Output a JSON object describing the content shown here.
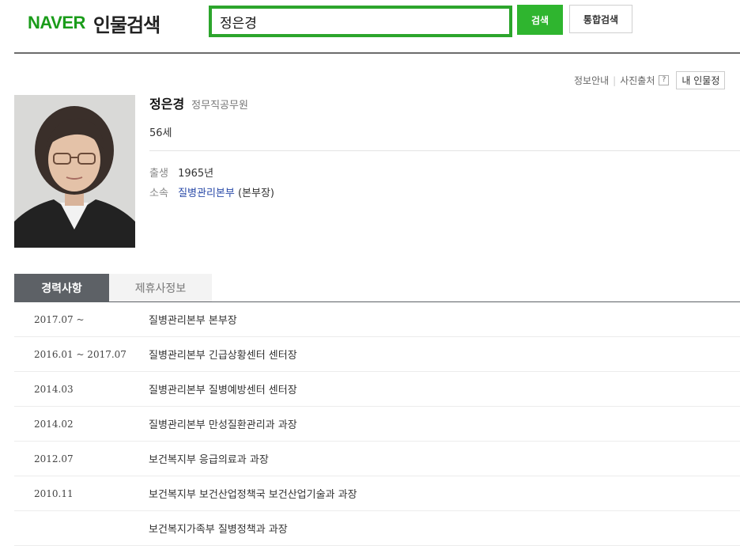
{
  "header": {
    "logo_brand": "NAVER",
    "logo_service": "인물검색",
    "search_value": "정은경",
    "search_button": "검색",
    "total_search_button": "통합검색"
  },
  "info_links": {
    "info": "정보안내",
    "photo_source": "사진출처",
    "help": "?",
    "my_person": "내 인물정"
  },
  "profile": {
    "name": "정은경",
    "job": "정무직공무원",
    "age": "56세",
    "birth_label": "출생",
    "birth_value": "1965년",
    "affiliation_label": "소속",
    "affiliation_link": "질병관리본부",
    "affiliation_role": " (본부장)"
  },
  "tabs": [
    {
      "label": "경력사항",
      "active": true
    },
    {
      "label": "제휴사정보",
      "active": false
    }
  ],
  "career": [
    {
      "period": "2017.07 ~",
      "desc": "질병관리본부 본부장"
    },
    {
      "period": "2016.01 ~ 2017.07",
      "desc": "질병관리본부 긴급상황센터 센터장"
    },
    {
      "period": "2014.03",
      "desc": "질병관리본부 질병예방센터 센터장"
    },
    {
      "period": "2014.02",
      "desc": "질병관리본부 만성질환관리과 과장"
    },
    {
      "period": "2012.07",
      "desc": "보건복지부 응급의료과 과장"
    },
    {
      "period": "2010.11",
      "desc": "보건복지부 보건산업정책국 보건산업기술과 과장"
    },
    {
      "period": "",
      "desc": "보건복지가족부 질병정책과 과장"
    }
  ],
  "colors": {
    "brand_green": "#2ca52c",
    "tab_active": "#5d6166",
    "link_blue": "#2a4aa8"
  }
}
